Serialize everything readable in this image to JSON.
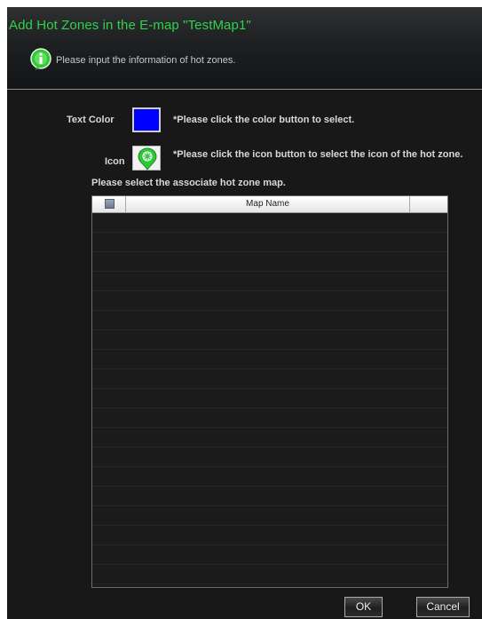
{
  "dialog": {
    "title": "Add Hot Zones in the E-map \"TestMap1\"",
    "subtitle": "Please input the information of hot zones."
  },
  "form": {
    "text_color_label": "Text Color",
    "text_color_value": "#0000ff",
    "text_color_hint": "*Please click the color button to select.",
    "icon_label": "Icon",
    "icon_hint": "*Please click the icon button to select the icon of the hot zone.",
    "map_select_prompt": "Please select the associate hot zone map."
  },
  "table": {
    "columns": [
      "",
      "Map Name",
      ""
    ],
    "rows": []
  },
  "buttons": {
    "ok": "OK",
    "cancel": "Cancel"
  },
  "colors": {
    "title_green": "#2fd24a",
    "background": "#181818"
  },
  "icons": {
    "info": "green-info-balloon-icon",
    "hot_zone": "green-map-pin-icon"
  }
}
